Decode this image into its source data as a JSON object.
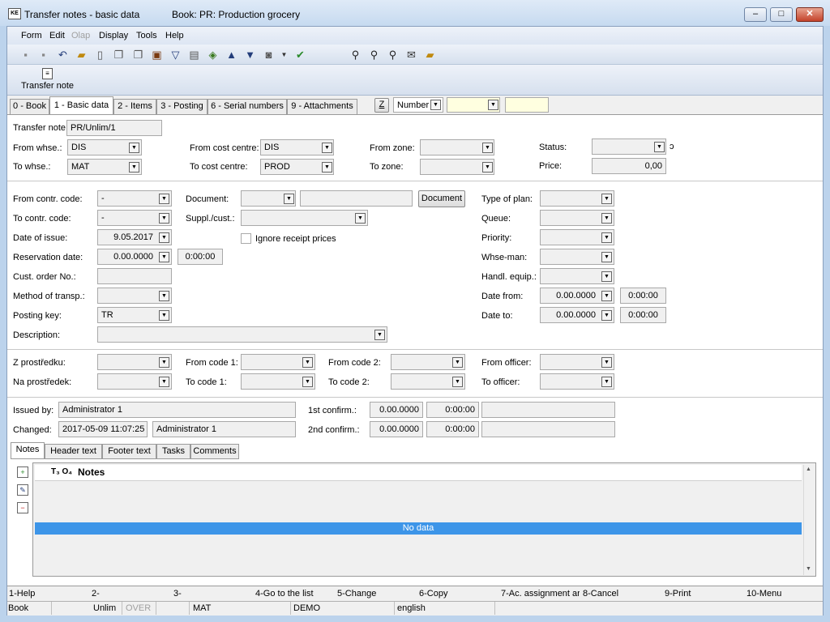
{
  "window": {
    "title": "Transfer notes - basic data",
    "book": "Book: PR: Production grocery",
    "app_icon": "KE"
  },
  "menu": [
    "Form",
    "Edit",
    "Olap",
    "Display",
    "Tools",
    "Help"
  ],
  "ribbon": {
    "transfer_note_label": "Transfer note"
  },
  "tabs": [
    "0 - Book",
    "1 - Basic data",
    "2 - Items",
    "3 - Posting",
    "6 - Serial numbers",
    "9 - Attachments"
  ],
  "search": {
    "z_label": "Z",
    "mode": "Number"
  },
  "head": {
    "transfer_note_label": "Transfer note",
    "transfer_note": "PR/Unlim/1",
    "from_whse_label": "From whse.:",
    "from_whse": "DIS",
    "to_whse_label": "To whse.:",
    "to_whse": "MAT",
    "from_cost_centre_label": "From cost centre:",
    "from_cost_centre": "DIS",
    "to_cost_centre_label": "To cost centre:",
    "to_cost_centre": "PROD",
    "from_zone_label": "From zone:",
    "to_zone_label": "To zone:",
    "status_label": "Status:",
    "price_label": "Price:",
    "price": "0,00"
  },
  "mid": {
    "from_contr_code_label": "From contr. code:",
    "from_contr_code": "-",
    "to_contr_code_label": "To contr. code:",
    "to_contr_code": "-",
    "date_of_issue_label": "Date of issue:",
    "date_of_issue": "9.05.2017",
    "reservation_date_label": "Reservation date:",
    "reservation_date": "0.00.0000",
    "reservation_time": "0:00:00",
    "cust_order_label": "Cust. order No.:",
    "method_transp_label": "Method of transp.:",
    "posting_key_label": "Posting key:",
    "posting_key": "TR",
    "description_label": "Description:",
    "document_label": "Document:",
    "document_button": "Document",
    "suppl_cust_label": "Suppl./cust.:",
    "ignore_receipt_label": "Ignore receipt prices",
    "type_of_plan_label": "Type of plan:",
    "queue_label": "Queue:",
    "priority_label": "Priority:",
    "whse_man_label": "Whse-man:",
    "handl_equip_label": "Handl. equip.:",
    "date_from_label": "Date from:",
    "date_from": "0.00.0000",
    "time_from": "0:00:00",
    "date_to_label": "Date to:",
    "date_to": "0.00.0000",
    "time_to": "0:00:00"
  },
  "codes": {
    "z_prostredku_label": "Z prostředku:",
    "na_prostredek_label": "Na prostředek:",
    "from_code1_label": "From code 1:",
    "to_code1_label": "To code 1:",
    "from_code2_label": "From code 2:",
    "to_code2_label": "To code 2:",
    "from_officer_label": "From officer:",
    "to_officer_label": "To officer:"
  },
  "audit": {
    "issued_by_label": "Issued by:",
    "issued_by": "Administrator 1",
    "changed_label": "Changed:",
    "changed_date": "2017-05-09 11:07:25",
    "changed_by": "Administrator 1",
    "confirm1_label": "1st confirm.:",
    "confirm1_date": "0.00.0000",
    "confirm1_time": "0:00:00",
    "confirm2_label": "2nd confirm.:",
    "confirm2_date": "0.00.0000",
    "confirm2_time": "0:00:00"
  },
  "note_tabs": [
    "Notes",
    "Header text",
    "Footer text",
    "Tasks",
    "Comments"
  ],
  "notes": {
    "column": "Notes",
    "column_prefix": "T₃ O₄",
    "empty": "No data"
  },
  "fkeys": [
    "1-Help",
    "2-",
    "3-",
    "4-Go to the list",
    "5-Change",
    "6-Copy",
    "7-Ac. assignment ar",
    "8-Cancel",
    "9-Print",
    "10-Menu"
  ],
  "status": [
    "Book",
    "Unlim",
    "OVER",
    "MAT",
    "DEMO",
    "english"
  ],
  "colors": {
    "selection": "#3d95e8",
    "titlebar": "#c6daf0",
    "highlight": "#ffffe0"
  }
}
